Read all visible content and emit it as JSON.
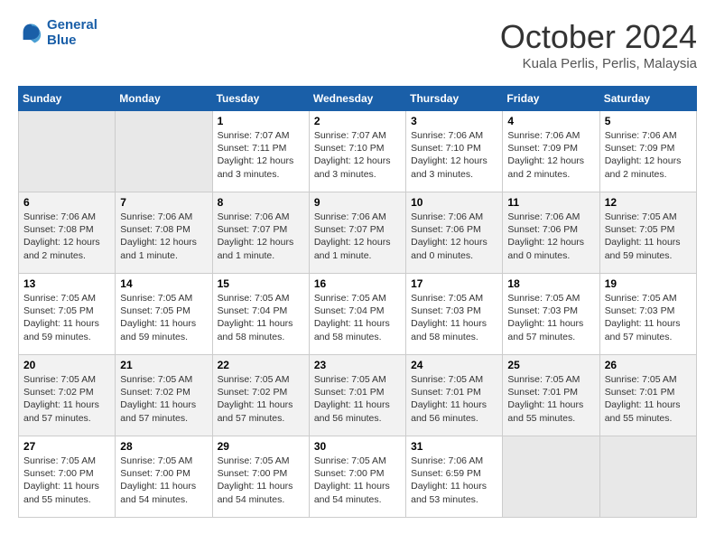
{
  "header": {
    "logo_line1": "General",
    "logo_line2": "Blue",
    "month": "October 2024",
    "location": "Kuala Perlis, Perlis, Malaysia"
  },
  "days_of_week": [
    "Sunday",
    "Monday",
    "Tuesday",
    "Wednesday",
    "Thursday",
    "Friday",
    "Saturday"
  ],
  "weeks": [
    [
      {
        "day": "",
        "info": ""
      },
      {
        "day": "",
        "info": ""
      },
      {
        "day": "1",
        "info": "Sunrise: 7:07 AM\nSunset: 7:11 PM\nDaylight: 12 hours\nand 3 minutes."
      },
      {
        "day": "2",
        "info": "Sunrise: 7:07 AM\nSunset: 7:10 PM\nDaylight: 12 hours\nand 3 minutes."
      },
      {
        "day": "3",
        "info": "Sunrise: 7:06 AM\nSunset: 7:10 PM\nDaylight: 12 hours\nand 3 minutes."
      },
      {
        "day": "4",
        "info": "Sunrise: 7:06 AM\nSunset: 7:09 PM\nDaylight: 12 hours\nand 2 minutes."
      },
      {
        "day": "5",
        "info": "Sunrise: 7:06 AM\nSunset: 7:09 PM\nDaylight: 12 hours\nand 2 minutes."
      }
    ],
    [
      {
        "day": "6",
        "info": "Sunrise: 7:06 AM\nSunset: 7:08 PM\nDaylight: 12 hours\nand 2 minutes."
      },
      {
        "day": "7",
        "info": "Sunrise: 7:06 AM\nSunset: 7:08 PM\nDaylight: 12 hours\nand 1 minute."
      },
      {
        "day": "8",
        "info": "Sunrise: 7:06 AM\nSunset: 7:07 PM\nDaylight: 12 hours\nand 1 minute."
      },
      {
        "day": "9",
        "info": "Sunrise: 7:06 AM\nSunset: 7:07 PM\nDaylight: 12 hours\nand 1 minute."
      },
      {
        "day": "10",
        "info": "Sunrise: 7:06 AM\nSunset: 7:06 PM\nDaylight: 12 hours\nand 0 minutes."
      },
      {
        "day": "11",
        "info": "Sunrise: 7:06 AM\nSunset: 7:06 PM\nDaylight: 12 hours\nand 0 minutes."
      },
      {
        "day": "12",
        "info": "Sunrise: 7:05 AM\nSunset: 7:05 PM\nDaylight: 11 hours\nand 59 minutes."
      }
    ],
    [
      {
        "day": "13",
        "info": "Sunrise: 7:05 AM\nSunset: 7:05 PM\nDaylight: 11 hours\nand 59 minutes."
      },
      {
        "day": "14",
        "info": "Sunrise: 7:05 AM\nSunset: 7:05 PM\nDaylight: 11 hours\nand 59 minutes."
      },
      {
        "day": "15",
        "info": "Sunrise: 7:05 AM\nSunset: 7:04 PM\nDaylight: 11 hours\nand 58 minutes."
      },
      {
        "day": "16",
        "info": "Sunrise: 7:05 AM\nSunset: 7:04 PM\nDaylight: 11 hours\nand 58 minutes."
      },
      {
        "day": "17",
        "info": "Sunrise: 7:05 AM\nSunset: 7:03 PM\nDaylight: 11 hours\nand 58 minutes."
      },
      {
        "day": "18",
        "info": "Sunrise: 7:05 AM\nSunset: 7:03 PM\nDaylight: 11 hours\nand 57 minutes."
      },
      {
        "day": "19",
        "info": "Sunrise: 7:05 AM\nSunset: 7:03 PM\nDaylight: 11 hours\nand 57 minutes."
      }
    ],
    [
      {
        "day": "20",
        "info": "Sunrise: 7:05 AM\nSunset: 7:02 PM\nDaylight: 11 hours\nand 57 minutes."
      },
      {
        "day": "21",
        "info": "Sunrise: 7:05 AM\nSunset: 7:02 PM\nDaylight: 11 hours\nand 57 minutes."
      },
      {
        "day": "22",
        "info": "Sunrise: 7:05 AM\nSunset: 7:02 PM\nDaylight: 11 hours\nand 57 minutes."
      },
      {
        "day": "23",
        "info": "Sunrise: 7:05 AM\nSunset: 7:01 PM\nDaylight: 11 hours\nand 56 minutes."
      },
      {
        "day": "24",
        "info": "Sunrise: 7:05 AM\nSunset: 7:01 PM\nDaylight: 11 hours\nand 56 minutes."
      },
      {
        "day": "25",
        "info": "Sunrise: 7:05 AM\nSunset: 7:01 PM\nDaylight: 11 hours\nand 55 minutes."
      },
      {
        "day": "26",
        "info": "Sunrise: 7:05 AM\nSunset: 7:01 PM\nDaylight: 11 hours\nand 55 minutes."
      }
    ],
    [
      {
        "day": "27",
        "info": "Sunrise: 7:05 AM\nSunset: 7:00 PM\nDaylight: 11 hours\nand 55 minutes."
      },
      {
        "day": "28",
        "info": "Sunrise: 7:05 AM\nSunset: 7:00 PM\nDaylight: 11 hours\nand 54 minutes."
      },
      {
        "day": "29",
        "info": "Sunrise: 7:05 AM\nSunset: 7:00 PM\nDaylight: 11 hours\nand 54 minutes."
      },
      {
        "day": "30",
        "info": "Sunrise: 7:05 AM\nSunset: 7:00 PM\nDaylight: 11 hours\nand 54 minutes."
      },
      {
        "day": "31",
        "info": "Sunrise: 7:06 AM\nSunset: 6:59 PM\nDaylight: 11 hours\nand 53 minutes."
      },
      {
        "day": "",
        "info": ""
      },
      {
        "day": "",
        "info": ""
      }
    ]
  ]
}
